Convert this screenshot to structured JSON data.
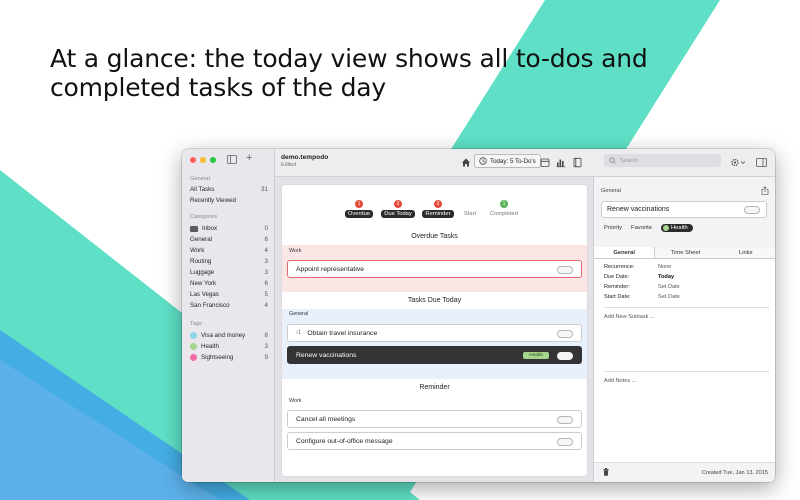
{
  "headline": {
    "line1": "At a glance: the today view shows all to-dos and",
    "line2": "completed tasks of the day"
  },
  "colors": {
    "teal": "#5fe0c6",
    "blue": "#3fa3e8",
    "overdue_red": "#e24b3b",
    "health_green": "#a8d58d"
  },
  "window": {
    "title": "demo.tempodo",
    "subtitle": "Edited",
    "today_button": "Today: 5 To-Do's",
    "search_placeholder": "Search"
  },
  "sidebar": {
    "general_header": "General",
    "general_items": [
      {
        "label": "All Tasks",
        "count": "31"
      },
      {
        "label": "Recently Viewed",
        "count": ""
      }
    ],
    "categories_header": "Categories",
    "categories": [
      {
        "label": "Inbox",
        "count": "0",
        "icon": "mail-icon"
      },
      {
        "label": "General",
        "count": "6"
      },
      {
        "label": "Work",
        "count": "4"
      },
      {
        "label": "Routing",
        "count": "3"
      },
      {
        "label": "Luggage",
        "count": "3"
      },
      {
        "label": "New York",
        "count": "6"
      },
      {
        "label": "Las Vegas",
        "count": "5"
      },
      {
        "label": "San Francisco",
        "count": "4"
      }
    ],
    "tags_header": "Tags",
    "tags": [
      {
        "label": "Visa and money",
        "count": "8",
        "color": "#8fd6e6"
      },
      {
        "label": "Health",
        "count": "3",
        "color": "#a8d58d"
      },
      {
        "label": "Sightseeing",
        "count": "9",
        "color": "#f06aa6"
      }
    ]
  },
  "filters": [
    {
      "label": "Overdue",
      "badge": "1",
      "badge_color": "red"
    },
    {
      "label": "Due Today",
      "badge": "2",
      "badge_color": "red"
    },
    {
      "label": "Reminder",
      "badge": "2",
      "badge_color": "red"
    },
    {
      "label": "Start",
      "badge": "",
      "badge_color": ""
    },
    {
      "label": "Completed",
      "badge": "1",
      "badge_color": "green"
    }
  ],
  "sections": {
    "overdue": {
      "title": "Overdue Tasks",
      "group": "Work",
      "tasks": [
        "Appoint representative"
      ]
    },
    "due_today": {
      "title": "Tasks Due Today",
      "group": "General",
      "tasks": [
        "Obtain travel insurance",
        "Renew vaccinations"
      ],
      "subtask_count": "1",
      "tag": "Health"
    },
    "reminder": {
      "title": "Reminder",
      "group": "Work",
      "tasks": [
        "Cancel all meetings",
        "Configure out-of-office message"
      ]
    }
  },
  "detail": {
    "group": "General",
    "title": "Renew vaccinations",
    "options": {
      "priority": "Priority",
      "favorite": "Favorite",
      "tag": "Health"
    },
    "tabs": [
      "General",
      "Time Sheet",
      "Links"
    ],
    "fields": [
      {
        "key": "Recurrence:",
        "value": "None",
        "bold": false
      },
      {
        "key": "Due Date:",
        "value": "Today",
        "bold": true
      },
      {
        "key": "Reminder:",
        "value": "Set Date",
        "bold": false
      },
      {
        "key": "Start Date:",
        "value": "Set Date",
        "bold": false
      }
    ],
    "add_subtask": "Add New Subtask ...",
    "add_notes": "Add Notes ...",
    "created": "Created Tue, Jan 13, 2015"
  }
}
